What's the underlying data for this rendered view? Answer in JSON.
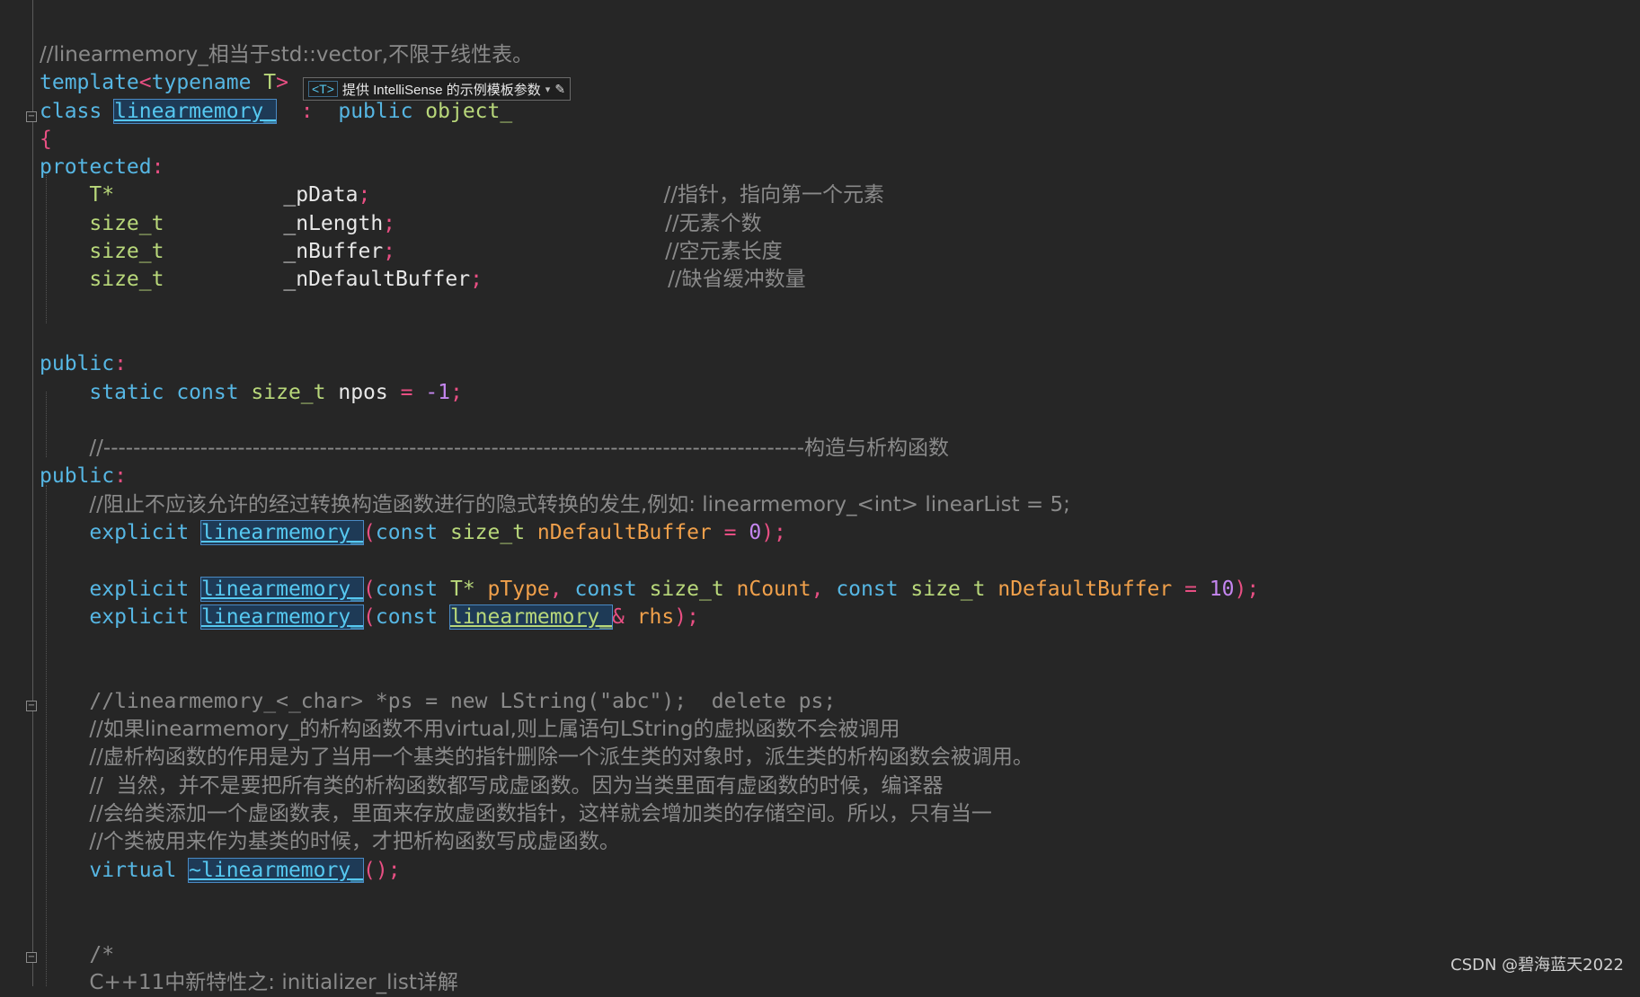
{
  "editor": {
    "l1_comment": "//linearmemory_相当于std::vector,不限于线性表。",
    "l2_template": "template",
    "l2_lt": "<",
    "l2_typename": "typename",
    "l2_T": " T",
    "l2_gt": ">",
    "l3_class": "class ",
    "l3_name": "linearmemory_",
    "l3_colon": "  :  ",
    "l3_public": "public ",
    "l3_base": "object_",
    "l4_brace": "{",
    "l5_protected": "protected",
    "l5_colon": ":",
    "m1_type": "T*",
    "m1_name": "_pData",
    "m1_semi": ";",
    "m1_cmt": "//指针，指向第一个元素",
    "m2_type": "size_t",
    "m2_name": "_nLength",
    "m2_semi": ";",
    "m2_cmt": "//无素个数",
    "m3_type": "size_t",
    "m3_name": "_nBuffer",
    "m3_semi": ";",
    "m3_cmt": "//空元素长度",
    "m4_type": "size_t",
    "m4_name": "_nDefaultBuffer",
    "m4_semi": ";",
    "m4_cmt": "//缺省缓冲数量",
    "pub1": "public",
    "pub_colon": ":",
    "npos_static": "static ",
    "npos_const": "const ",
    "npos_type": "size_t ",
    "npos_name": "npos ",
    "npos_eq": "= ",
    "npos_val": "-1",
    "npos_semi": ";",
    "sep_comment": "//----------------------------------------------------------------------------------------------构造与析构函数",
    "pub2": "public",
    "explicit_comment": "//阻止不应该允许的经过转换构造函数进行的隐式转换的发生,例如: linearmemory_<int> linearList = 5;",
    "explicit": "explicit ",
    "ctor_name": "linearmemory_",
    "lparen": "(",
    "const": "const ",
    "size_t": "size_t ",
    "ctor1_param": "nDefaultBuffer",
    "eq": " = ",
    "ctor1_val": "0",
    "close_semi": ");",
    "T_star": "T* ",
    "ctor2_p1": "pType",
    "comma": ", ",
    "ctor2_p2": "nCount",
    "ctor2_p3": "nDefaultBuffer",
    "ctor2_val": "10",
    "ctor3_type": "linearmemory_",
    "amp": "&",
    "ctor3_param": " rhs",
    "c1": "//linearmemory_<_char> *ps = new LString(\"abc\");  delete ps;",
    "c2": "//如果linearmemory_的析构函数不用virtual,则上属语句LString的虚拟函数不会被调用",
    "c3": "//虚析构函数的作用是为了当用一个基类的指针删除一个派生类的对象时，派生类的析构函数会被调用。",
    "c4": "//  当然，并不是要把所有类的析构函数都写成虚函数。因为当类里面有虚函数的时候，编译器",
    "c5": "//会给类添加一个虚函数表，里面来存放虚函数指针，这样就会增加类的存储空间。所以，只有当一",
    "c6": "//个类被用来作为基类的时候，才把析构函数写成虚函数。",
    "virtual": "virtual ",
    "dtor_name": "~linearmemory_",
    "dtor_tail": "();",
    "block_open": "/*",
    "block_line": "C++11中新特性之: initializer_list详解"
  },
  "intellisense": {
    "tag": "<T>",
    "label": "提供 IntelliSense 的示例模板参数",
    "dropdown_arrow": "▾",
    "edit_icon": "✎"
  },
  "fold_icon": "−",
  "watermark": "CSDN @碧海蓝天2022"
}
